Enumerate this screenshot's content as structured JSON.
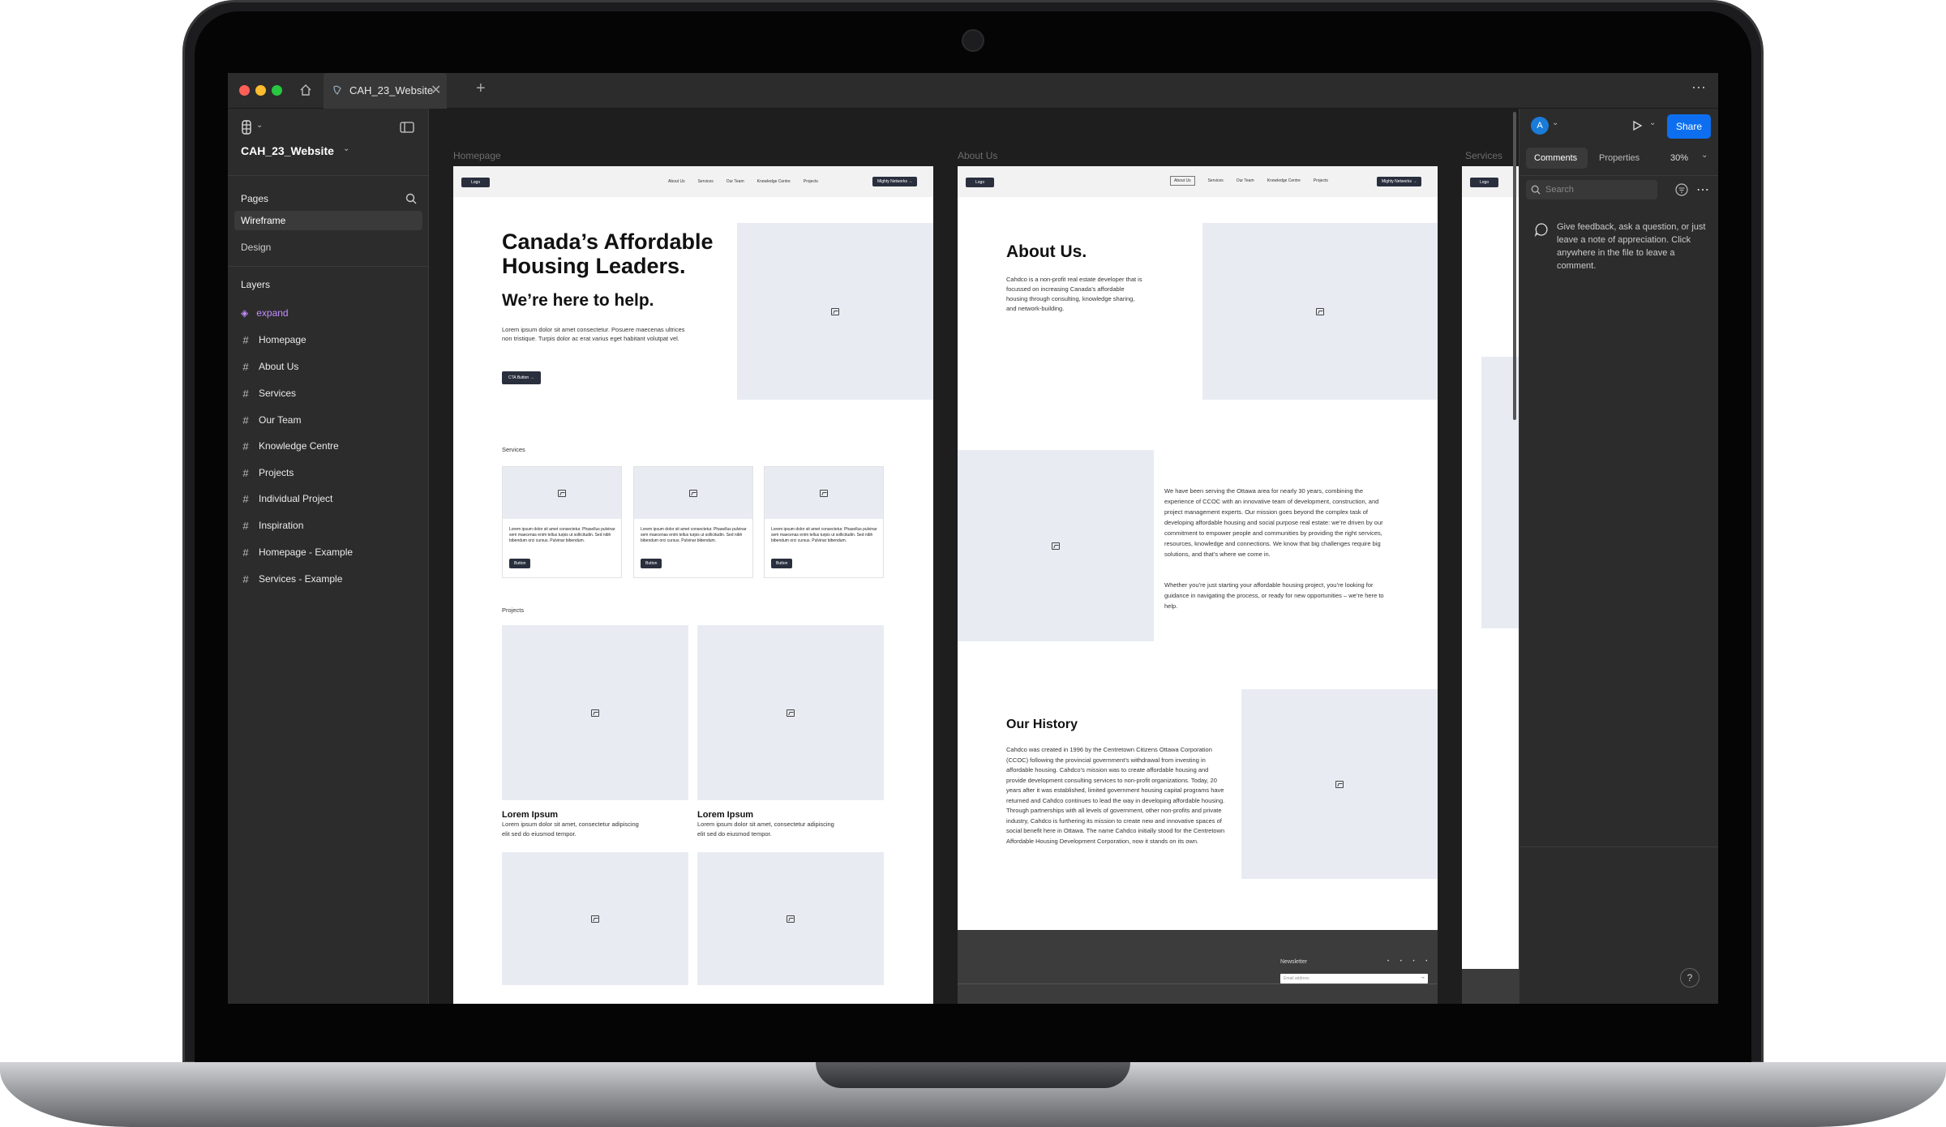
{
  "tab": {
    "title": "CAH_23_Website"
  },
  "file": {
    "name": "CAH_23_Website"
  },
  "pages": {
    "header": "Pages",
    "items": [
      "Wireframe",
      "Design"
    ]
  },
  "layers": {
    "header": "Layers",
    "items": [
      "expand",
      "Homepage",
      "About Us",
      "Services",
      "Our Team",
      "Knowledge Centre",
      "Projects",
      "Individual Project",
      "Inspiration",
      "Homepage - Example",
      "Services - Example"
    ]
  },
  "right": {
    "avatar": "A",
    "share": "Share",
    "tab_comments": "Comments",
    "tab_properties": "Properties",
    "zoom": "30%",
    "search_placeholder": "Search",
    "hint": "Give feedback, ask a question, or just leave a note of appreciation. Click anywhere in the file to leave a comment.",
    "help": "?"
  },
  "frames": {
    "homepage": {
      "label": "Homepage",
      "logo": "Logo",
      "nav": [
        "About Us",
        "Services",
        "Our Team",
        "Knowledge Centre",
        "Projects"
      ],
      "nav_cta": "Mighty Networks",
      "hero_title": "Canada’s Affordable Housing Leaders.",
      "hero_sub": "We’re here to help.",
      "hero_body": "Lorem ipsum dolor sit amet consectetur. Posuere maecenas ultrices non tristique. Turpis dolor ac erat varius eget habitant volutpat vel.",
      "cta": "CTA Button",
      "services_label": "Services",
      "card_text": "Lorem ipsum dolor sit amet consectetur. Phasellus pulvinar sem maecenas enim tellus turpis ut sollicitudin. Sed nibh bibendum orci cursus. Pulvinar bibendum.",
      "card_button": "Button",
      "projects_label": "Projects",
      "project_title": "Lorem Ipsum",
      "project_body": "Lorem ipsum dolor sit amet, consectetur adipiscing elit sed do eiusmod tempor."
    },
    "about": {
      "label": "About Us",
      "title": "About Us.",
      "intro": "Cahdco is a non-profit real estate developer that is focussed on increasing Canada’s affordable housing through consulting, knowledge sharing, and network-building.",
      "body1": "We have been serving the Ottawa area for nearly 30 years, combining the experience of CCOC with an innovative team of development, construction, and project management experts. Our mission goes beyond the complex task of developing affordable housing and social purpose real estate: we’re driven by our commitment to empower people and communities by providing the right services, resources, knowledge and connections. We know that big challenges require big solutions, and that’s where we come in.",
      "body2": "Whether you’re just starting your affordable housing project, you’re looking for guidance in navigating the process, or ready for new opportunities – we’re here to help.",
      "history_title": "Our History",
      "history_body": "Cahdco was created in 1996 by the Centretown Citizens Ottawa Corporation (CCOC) following the provincial government’s withdrawal from investing in affordable housing. Cahdco’s mission was to create affordable housing and provide development consulting services to non-profit organizations. Today, 20 years after it was established, limited government housing capital programs have returned and Cahdco continues to lead the way in developing affordable housing. Through partnerships with all levels of government, other non-profits and private industry, Cahdco is furthering its mission to create new and innovative spaces of social benefit here in Ottawa. The name Cahdco initially stood for the Centretown Affordable Housing Development Corporation, now it stands on its own.",
      "newsletter": "Newsletter",
      "email_placeholder": "Email address"
    },
    "services": {
      "label": "Services"
    }
  }
}
